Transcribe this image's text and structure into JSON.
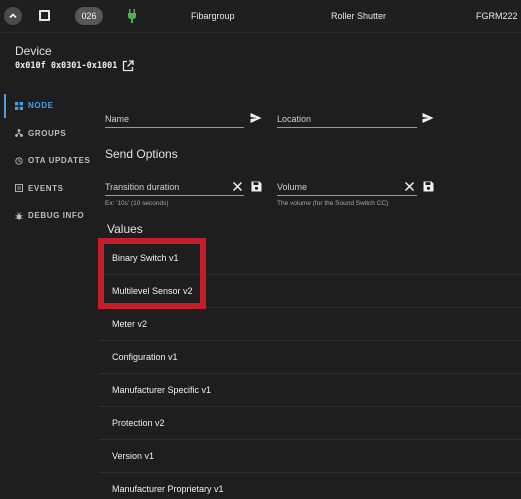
{
  "header": {
    "node_id": "026",
    "manufacturer": "Fibargroup",
    "product": "Roller Shutter",
    "model": "FGRM222"
  },
  "device": {
    "title": "Device",
    "ids": "0x010f 0x0301-0x1001"
  },
  "sidebar": {
    "items": [
      {
        "label": "NODE",
        "active": true
      },
      {
        "label": "GROUPS",
        "active": false
      },
      {
        "label": "OTA UPDATES",
        "active": false
      },
      {
        "label": "EVENTS",
        "active": false
      },
      {
        "label": "DEBUG INFO",
        "active": false
      }
    ]
  },
  "form": {
    "name_label": "Name",
    "location_label": "Location",
    "send_options_heading": "Send Options",
    "duration_label": "Transition duration",
    "duration_hint": "Ex: '10s' (10 seconds)",
    "volume_label": "Volume",
    "volume_hint": "The volume (for the Sound Switch CC)"
  },
  "values": {
    "heading": "Values",
    "items": [
      "Binary Switch v1",
      "Multilevel Sensor v2",
      "Meter v2",
      "Configuration v1",
      "Manufacturer Specific v1",
      "Protection v2",
      "Version v1",
      "Manufacturer Proprietary v1"
    ]
  },
  "colors": {
    "accent": "#4a9eea",
    "highlight": "#c31f2a",
    "plug": "#4caf50"
  },
  "icons": {
    "collapse": "chevron-up-icon",
    "plug": "power-plug-icon",
    "open": "open-in-new-icon",
    "send": "send-icon",
    "clear": "close-icon",
    "save": "save-icon"
  }
}
